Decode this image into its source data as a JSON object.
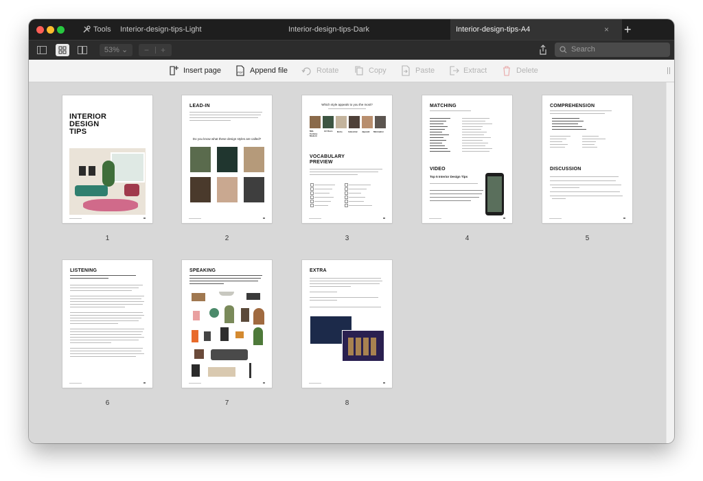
{
  "window": {
    "tools_label": "Tools",
    "tabs": [
      {
        "label": "Interior-design-tips-Light"
      },
      {
        "label": "Interior-design-tips-Dark"
      },
      {
        "label": "Interior-design-tips-A4"
      }
    ],
    "tab_close": "×",
    "tab_add": "+"
  },
  "toolbar": {
    "zoom": "53%",
    "zoom_minus": "−",
    "zoom_plus": "+",
    "search_placeholder": "Search"
  },
  "actions": [
    {
      "label": "Insert page",
      "icon": "insert-page-icon",
      "enabled": true
    },
    {
      "label": "Append file",
      "icon": "append-file-icon",
      "enabled": true
    },
    {
      "label": "Rotate",
      "icon": "rotate-icon",
      "enabled": false
    },
    {
      "label": "Copy",
      "icon": "copy-icon",
      "enabled": false
    },
    {
      "label": "Paste",
      "icon": "paste-icon",
      "enabled": false
    },
    {
      "label": "Extract",
      "icon": "extract-icon",
      "enabled": false
    },
    {
      "label": "Delete",
      "icon": "delete-icon",
      "enabled": false
    }
  ],
  "pages": [
    {
      "number": "1",
      "heading": "INTERIOR DESIGN TIPS",
      "heading_lines": [
        "INTERIOR",
        "DESIGN",
        "TIPS"
      ]
    },
    {
      "number": "2",
      "heading": "LEAD-IN",
      "subheading": "Do you know what these design styles are called?"
    },
    {
      "number": "3",
      "heading": "Which style appeals to you the most?",
      "heading2": "VOCABULARY PREVIEW",
      "heading2_lines": [
        "VOCABULARY",
        "PREVIEW"
      ],
      "styles": [
        "Mid-Century Modern",
        "Art Deco",
        "Boho",
        "Industrial",
        "Japandi",
        "Minimalist"
      ]
    },
    {
      "number": "4",
      "heading": "MATCHING",
      "heading2": "VIDEO",
      "subheading": "Top 5 Interior Design Tips"
    },
    {
      "number": "5",
      "heading": "COMPREHENSION",
      "heading2": "DISCUSSION"
    },
    {
      "number": "6",
      "heading": "LISTENING"
    },
    {
      "number": "7",
      "heading": "SPEAKING"
    },
    {
      "number": "8",
      "heading": "EXTRA"
    }
  ],
  "colors": {
    "titlebar": "#1e1e1e",
    "toolbar_dark": "#2c2c2c",
    "toolbar_light": "#f3f3f3",
    "content_bg": "#d8d8d8",
    "active_tab": "#333333"
  }
}
